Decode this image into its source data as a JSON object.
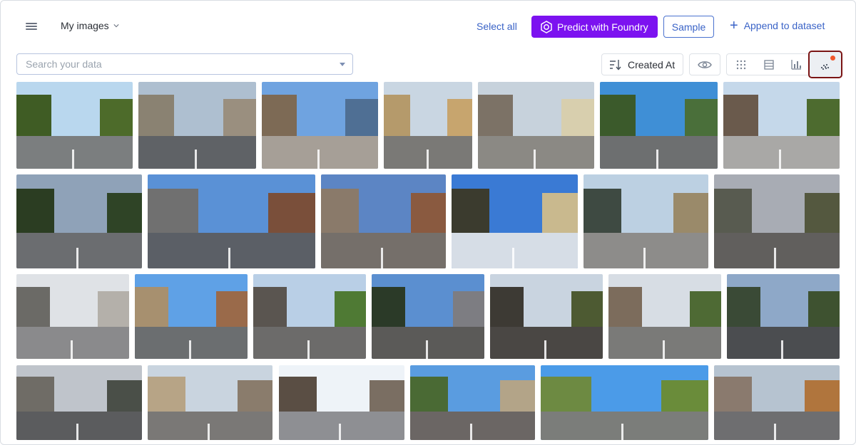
{
  "header": {
    "dataset_label": "My images",
    "select_all_label": "Select all",
    "predict_label": "Predict with Foundry",
    "sample_label": "Sample",
    "append_label": "Append to dataset"
  },
  "toolbar": {
    "search_placeholder": "Search your data",
    "sort_label": "Created At",
    "views": [
      "grid-view",
      "list-view",
      "chart-view",
      "embedding-view"
    ],
    "active_view": "embedding-view"
  },
  "colors": {
    "accent": "#7c12f0",
    "link": "#3a63c7",
    "active_outline": "#7a1414",
    "notification_dot": "#f0562b"
  },
  "gallery": {
    "rows": [
      [
        {
          "sky": "#b9d7ee",
          "ground": "#7b7e7f",
          "left": "#3f5c24",
          "right": "#4d6b2a"
        },
        {
          "sky": "#aebfd0",
          "ground": "#5f6266",
          "left": "#8a8272",
          "right": "#9a8f7f"
        },
        {
          "sky": "#6fa3e0",
          "ground": "#a69f97",
          "left": "#7d6a55",
          "right": "#4f6f94"
        },
        {
          "sky": "#c9d6e2",
          "ground": "#7a7976",
          "left": "#b59a6b",
          "right": "#c7a56e"
        },
        {
          "sky": "#c7d2dc",
          "ground": "#8b8984",
          "left": "#7c7266",
          "right": "#d8cfae"
        },
        {
          "sky": "#3f8fd6",
          "ground": "#6d6f70",
          "left": "#3b5a2b",
          "right": "#4a6f3a"
        },
        {
          "sky": "#c5d8ea",
          "ground": "#a9a8a6",
          "left": "#6a5a4c",
          "right": "#4d6b2f"
        }
      ],
      [
        {
          "sky": "#8fa2b8",
          "ground": "#6b6d70",
          "left": "#2b3d22",
          "right": "#2f4426"
        },
        {
          "sky": "#5a91d6",
          "ground": "#5b5f66",
          "left": "#707070",
          "right": "#7a4f3a"
        },
        {
          "sky": "#5c85c4",
          "ground": "#756f6a",
          "left": "#8a7a6a",
          "right": "#8a5a40"
        },
        {
          "sky": "#3a7ad4",
          "ground": "#d6dde6",
          "left": "#3b3b2e",
          "right": "#c9b98e"
        },
        {
          "sky": "#bcd0e2",
          "ground": "#8d8c8a",
          "left": "#3e4a42",
          "right": "#9a8a6a"
        },
        {
          "sky": "#a8acb4",
          "ground": "#615f5d",
          "left": "#585b50",
          "right": "#54583f"
        }
      ],
      [
        {
          "sky": "#dfe2e6",
          "ground": "#8a8a8c",
          "left": "#6b6a66",
          "right": "#b4b0aa"
        },
        {
          "sky": "#5fa1e6",
          "ground": "#6b6e70",
          "left": "#a7906f",
          "right": "#9a6a4a"
        },
        {
          "sky": "#b9cfe6",
          "ground": "#6c6b6a",
          "left": "#5a5550",
          "right": "#4f7a34"
        },
        {
          "sky": "#5b8fd0",
          "ground": "#5b5a58",
          "left": "#2b3a28",
          "right": "#7d7d82"
        },
        {
          "sky": "#c9d4e0",
          "ground": "#4a4744",
          "left": "#3d3a34",
          "right": "#4d5a32"
        },
        {
          "sky": "#d7dde4",
          "ground": "#7a7a78",
          "left": "#7c6c5c",
          "right": "#4e6a34"
        },
        {
          "sky": "#8ea8c8",
          "ground": "#4b4d50",
          "left": "#3a4a36",
          "right": "#3e5230"
        }
      ],
      [
        {
          "sky": "#bfc4cb",
          "ground": "#5b5c5e",
          "left": "#6f6c66",
          "right": "#4a4f48"
        },
        {
          "sky": "#c9d4df",
          "ground": "#7a7876",
          "left": "#b7a486",
          "right": "#8a7c6c"
        },
        {
          "sky": "#eef3f8",
          "ground": "#8e8f93",
          "left": "#5a4e44",
          "right": "#7a6e62"
        },
        {
          "sky": "#5a9ce0",
          "ground": "#6b6664",
          "left": "#4a6a34",
          "right": "#b3a488"
        },
        {
          "sky": "#4b9be8",
          "ground": "#7b7d7a",
          "left": "#6d8a42",
          "right": "#6a8c3a"
        },
        {
          "sky": "#b6c3d0",
          "ground": "#6e6e70",
          "left": "#8a7a6e",
          "right": "#b0753d"
        }
      ]
    ]
  }
}
